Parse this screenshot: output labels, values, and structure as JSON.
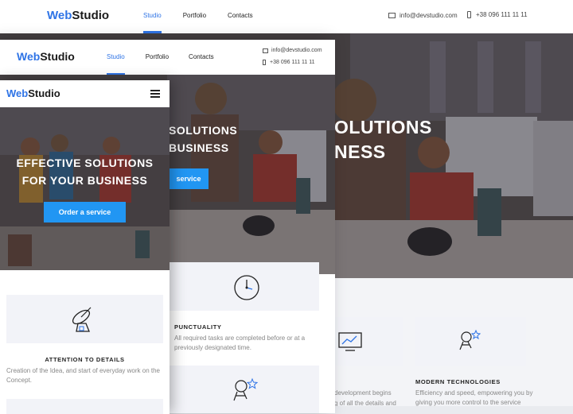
{
  "brand": {
    "part1": "Web",
    "part2": "Studio"
  },
  "nav": {
    "studio": "Studio",
    "portfolio": "Portfolio",
    "contacts": "Contacts"
  },
  "contact": {
    "email": "info@devstudio.com",
    "phone": "+38 096 111 11 11"
  },
  "hero": {
    "line1": "Effective solutions",
    "line2": "for your business",
    "line1_cut_tablet": "SOLUTIONS",
    "line2_cut_tablet": "BUSINESS",
    "line1_cut_desktop": "OLUTIONS",
    "line2_cut_desktop": "NESS",
    "button": "Order a service",
    "button_cut": "service"
  },
  "features": {
    "attention": {
      "title": "Attention to details",
      "text": "Creation of the Idea, and start of everyday work on the Concept."
    },
    "punctuality": {
      "title": "Punctuality",
      "text": "All required tasks are completed before or at a previously designated time."
    },
    "modern": {
      "title": "Modern technologies",
      "text": "Efficiency and speed, empowering you by giving you more control to the service"
    },
    "development_fragment": {
      "line1": "development begins",
      "line2": "g of all the details and"
    }
  },
  "colors": {
    "accent": "#2f74e6",
    "button": "#2196f3",
    "card": "#f2f3f8"
  },
  "icons": [
    "envelope-icon",
    "phone-icon",
    "hamburger-menu-icon",
    "satellite-dish-icon",
    "clock-icon",
    "astronaut-icon",
    "monitor-chart-icon"
  ]
}
